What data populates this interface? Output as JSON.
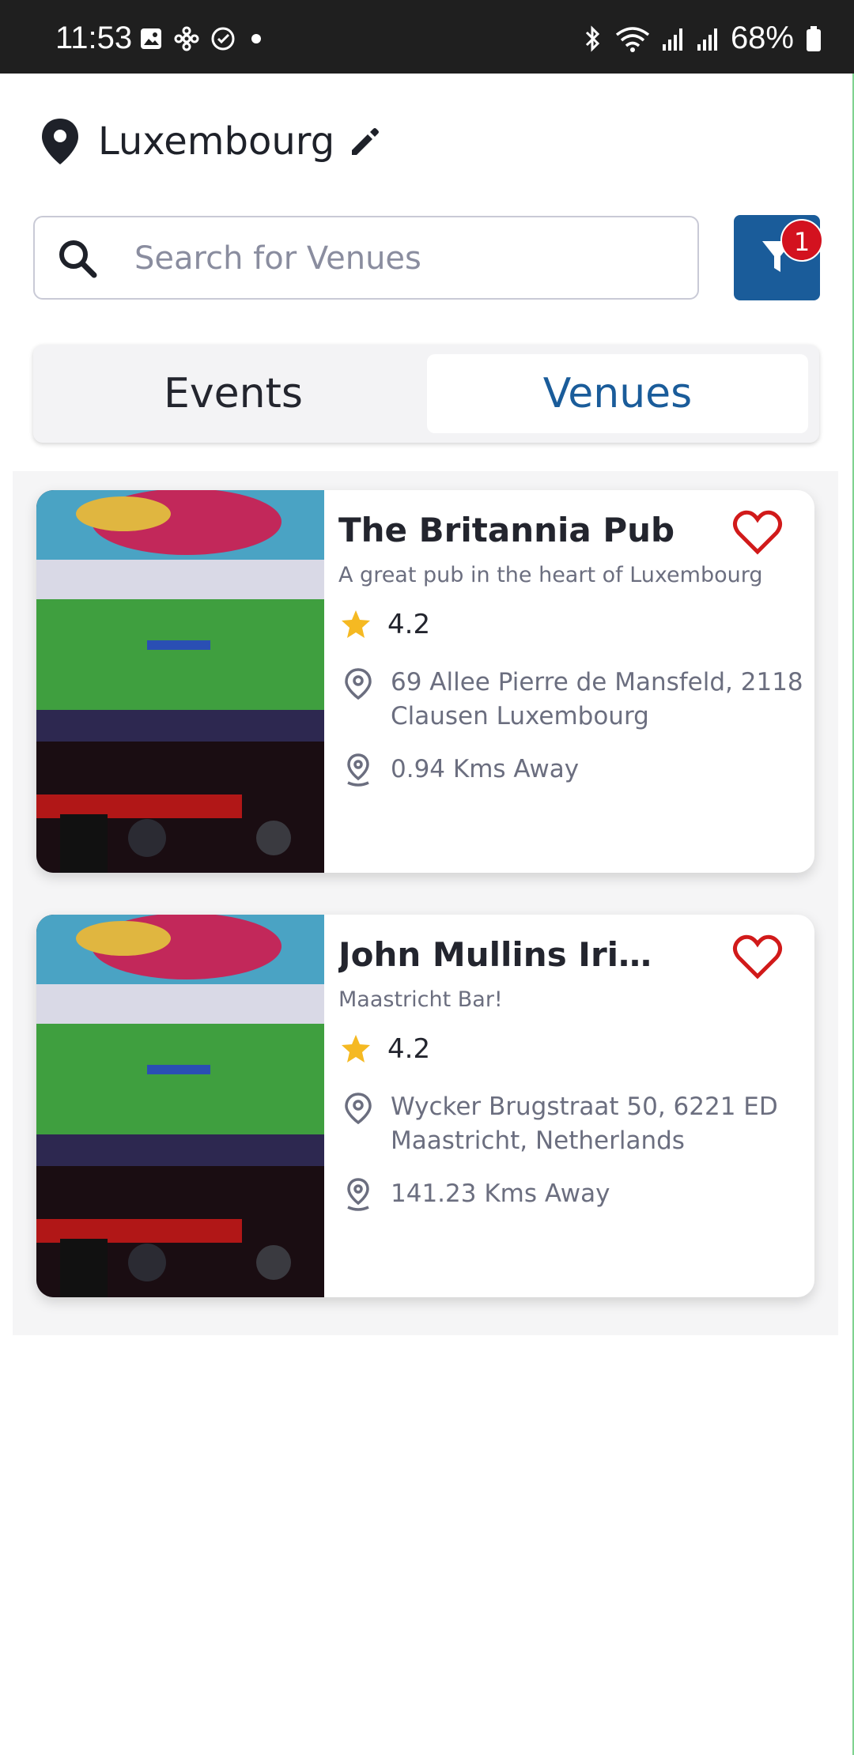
{
  "status_bar": {
    "time": "11:53",
    "battery": "68%"
  },
  "location": {
    "name": "Luxembourg"
  },
  "search": {
    "placeholder": "Search for Venues"
  },
  "filter": {
    "badge_count": "1"
  },
  "tabs": [
    {
      "label": "Events",
      "selected": false
    },
    {
      "label": "Venues",
      "selected": true
    }
  ],
  "venues": [
    {
      "name": "The Britannia Pub",
      "description": "A great pub in the heart of Luxembourg",
      "rating": "4.2",
      "address": "69 Allee Pierre de Mansfeld, 2118 Clausen Luxembourg",
      "distance": "0.94 Kms Away",
      "favorite": true
    },
    {
      "name": "John Mullins Irish Pub",
      "description": "Maastricht Bar!",
      "rating": "4.2",
      "address": "Wycker Brugstraat 50, 6221 ED Maastricht, Netherlands",
      "distance": "141.23 Kms Away",
      "favorite": true
    }
  ],
  "colors": {
    "accent": "#1a5c9a",
    "badge": "#d3121f",
    "heart": "#d11a1a",
    "star": "#f5b922"
  }
}
